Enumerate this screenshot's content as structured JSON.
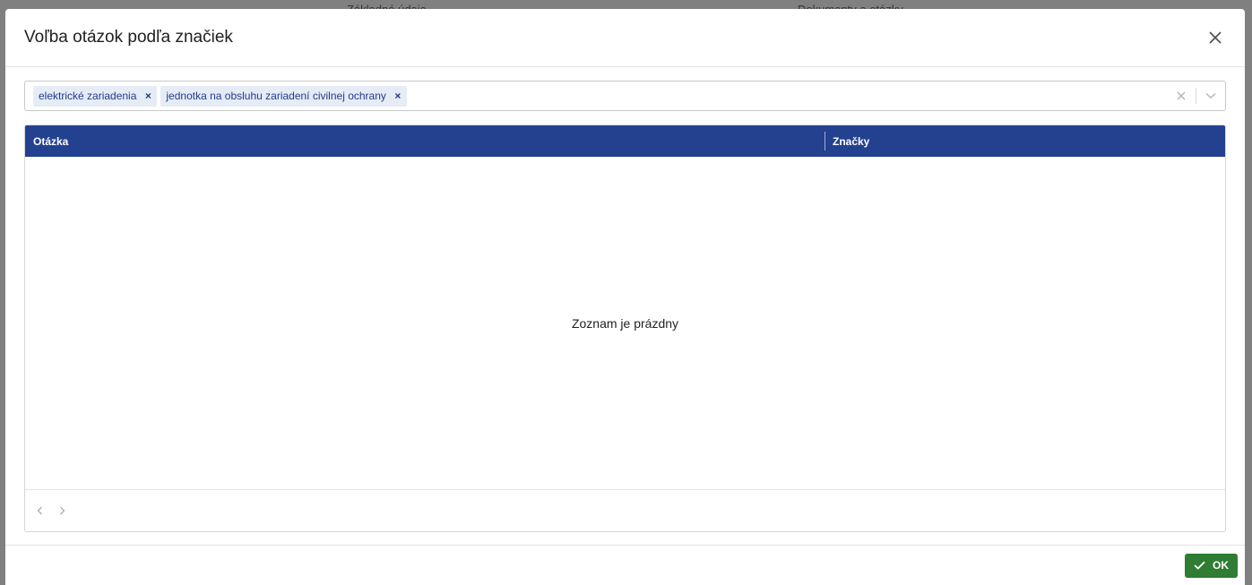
{
  "backdrop": {
    "left_text": "Základné údaje",
    "right_text": "Dokumenty a otázky"
  },
  "modal": {
    "title": "Voľba otázok podľa značiek",
    "close_icon": "close-icon"
  },
  "tag_filter": {
    "tags": [
      {
        "label": "elektrické zariadenia"
      },
      {
        "label": "jednotka na obsluhu zariadení civilnej ochrany"
      }
    ],
    "remove_glyph": "×",
    "clear_icon": "clear-icon",
    "dropdown_icon": "chevron-down-icon"
  },
  "grid": {
    "columns": {
      "question": "Otázka",
      "tags": "Značky"
    },
    "empty_message": "Zoznam je prázdny",
    "header_color": "#24418f"
  },
  "footer": {
    "ok_label": "OK",
    "ok_color": "#2e7d32",
    "ok_icon": "check-icon"
  }
}
